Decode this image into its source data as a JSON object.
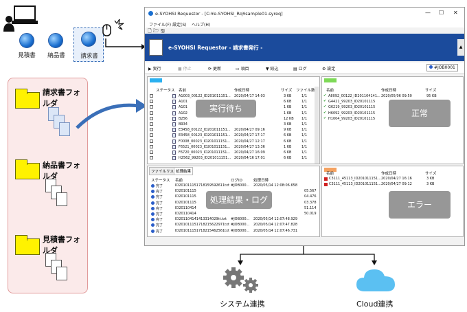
{
  "docs": [
    {
      "label": "見積書"
    },
    {
      "label": "納品書"
    },
    {
      "label": "請求書"
    }
  ],
  "folders": [
    {
      "label": "請求書フォルダ"
    },
    {
      "label": "納品書フォルダ"
    },
    {
      "label": "見積書フォルダ"
    }
  ],
  "window": {
    "title": "e-SYOHSI Requestor - [C:¥e-SYOHSI_Rq¥sample01.syreq]",
    "menu": [
      "ファイル(F)",
      "設定(S)",
      "ヘルプ(H)"
    ],
    "banner_title": "e-SYOHSI Requestor - 請求書発行 -",
    "toolbar": [
      "実行",
      "停止",
      "更新",
      "項目",
      "絞込",
      "ログ",
      "設定"
    ],
    "job_id": "#JOB0001"
  },
  "queue": {
    "headers": [
      "ステータス",
      "名前",
      "作成日時",
      "サイズ",
      "ファイル数"
    ],
    "rows": [
      [
        "A1003_00122_ID201011151...",
        "2020/04/17 14:03",
        "3 KB",
        "1/1"
      ],
      [
        "A101",
        "",
        "6 KB",
        "1/1"
      ],
      [
        "A101",
        "",
        "1 KB",
        "1/1"
      ],
      [
        "A102",
        "",
        "1 KB",
        "1/1"
      ],
      [
        "B256",
        "",
        "12 KB",
        "1/1"
      ],
      [
        "B934",
        "",
        "3 KB",
        "1/1"
      ],
      [
        "E3458_00122_ID201011151...",
        "2020/04/27 09:16",
        "9 KB",
        "1/1"
      ],
      [
        "E3458_00123_ID201011151...",
        "2020/04/27 17:17",
        "6 KB",
        "1/1"
      ],
      [
        "F0008_00023_ID201011151...",
        "2020/04/27 12:17",
        "6 KB",
        "1/1"
      ],
      [
        "F6521_00023_ID201011151...",
        "2020/04/27 13:36",
        "1 KB",
        "1/1"
      ],
      [
        "F6720_00023_ID201011151...",
        "2020/04/27 16:09",
        "6 KB",
        "1/1"
      ],
      [
        "H2562_99203_ID201011151...",
        "2020/04/16 17:01",
        "6 KB",
        "1/1"
      ]
    ],
    "overlay": "実行待ち"
  },
  "log": {
    "tabs": [
      "ファイルリスト",
      "処理結果"
    ],
    "headers": [
      "ステータス",
      "名前",
      "ログID",
      "処理日時"
    ],
    "rows": [
      [
        "完了",
        "ID201011151718159592611txt",
        "#JOB000...",
        "2020/05/14 12:08:06.658"
      ],
      [
        "完了",
        "ID20101115",
        "",
        "05.567"
      ],
      [
        "完了",
        "ID20101115",
        "",
        "04.476"
      ],
      [
        "完了",
        "ID20101115",
        "",
        "03.378"
      ],
      [
        "完了",
        "ID20110414",
        "",
        "51.114"
      ],
      [
        "完了",
        "ID20110414",
        "",
        "50.019"
      ],
      [
        "完了",
        "ID201104141413314029tt.txt",
        "#JOB000...",
        "2020/05/14 12:07:48.929"
      ],
      [
        "完了",
        "ID201011151718215622971txt",
        "#JOB000...",
        "2020/05/14 12:07:47.828"
      ],
      [
        "完了",
        "ID201011151718215462561txt",
        "#JOB000...",
        "2020/05/14 12:07:46.731"
      ]
    ],
    "overlay": "処理結果・ログ"
  },
  "success": {
    "headers": [
      "名前",
      "作成日時",
      "サイズ"
    ],
    "rows": [
      [
        "A8092_00122_ID201104141...",
        "2020/05/06 09:50",
        "95 KB"
      ],
      [
        "G4421_99203_ID20101115",
        "",
        ""
      ],
      [
        "G6219_99203_ID20101115",
        "",
        ""
      ],
      [
        "H6092_99203_ID20101115",
        "",
        ""
      ],
      [
        "H1004_99203_ID20101115",
        "",
        ""
      ]
    ],
    "overlay": "正常",
    "color": "#7ed957"
  },
  "error": {
    "headers": [
      "名前",
      "作成日時",
      "サイズ"
    ],
    "rows": [
      [
        "C3111_45113_ID201011151...",
        "2020/04/27 16:16",
        "3 KB"
      ],
      [
        "C3111_45113_ID201011151...",
        "2020/04/27 09:12",
        "3 KB"
      ]
    ],
    "overlay": "エラー",
    "color": "#f4a261"
  },
  "queue_color": "#2ab0f0",
  "outputs": [
    {
      "label": "システム連携"
    },
    {
      "label": "Cloud連携"
    }
  ]
}
